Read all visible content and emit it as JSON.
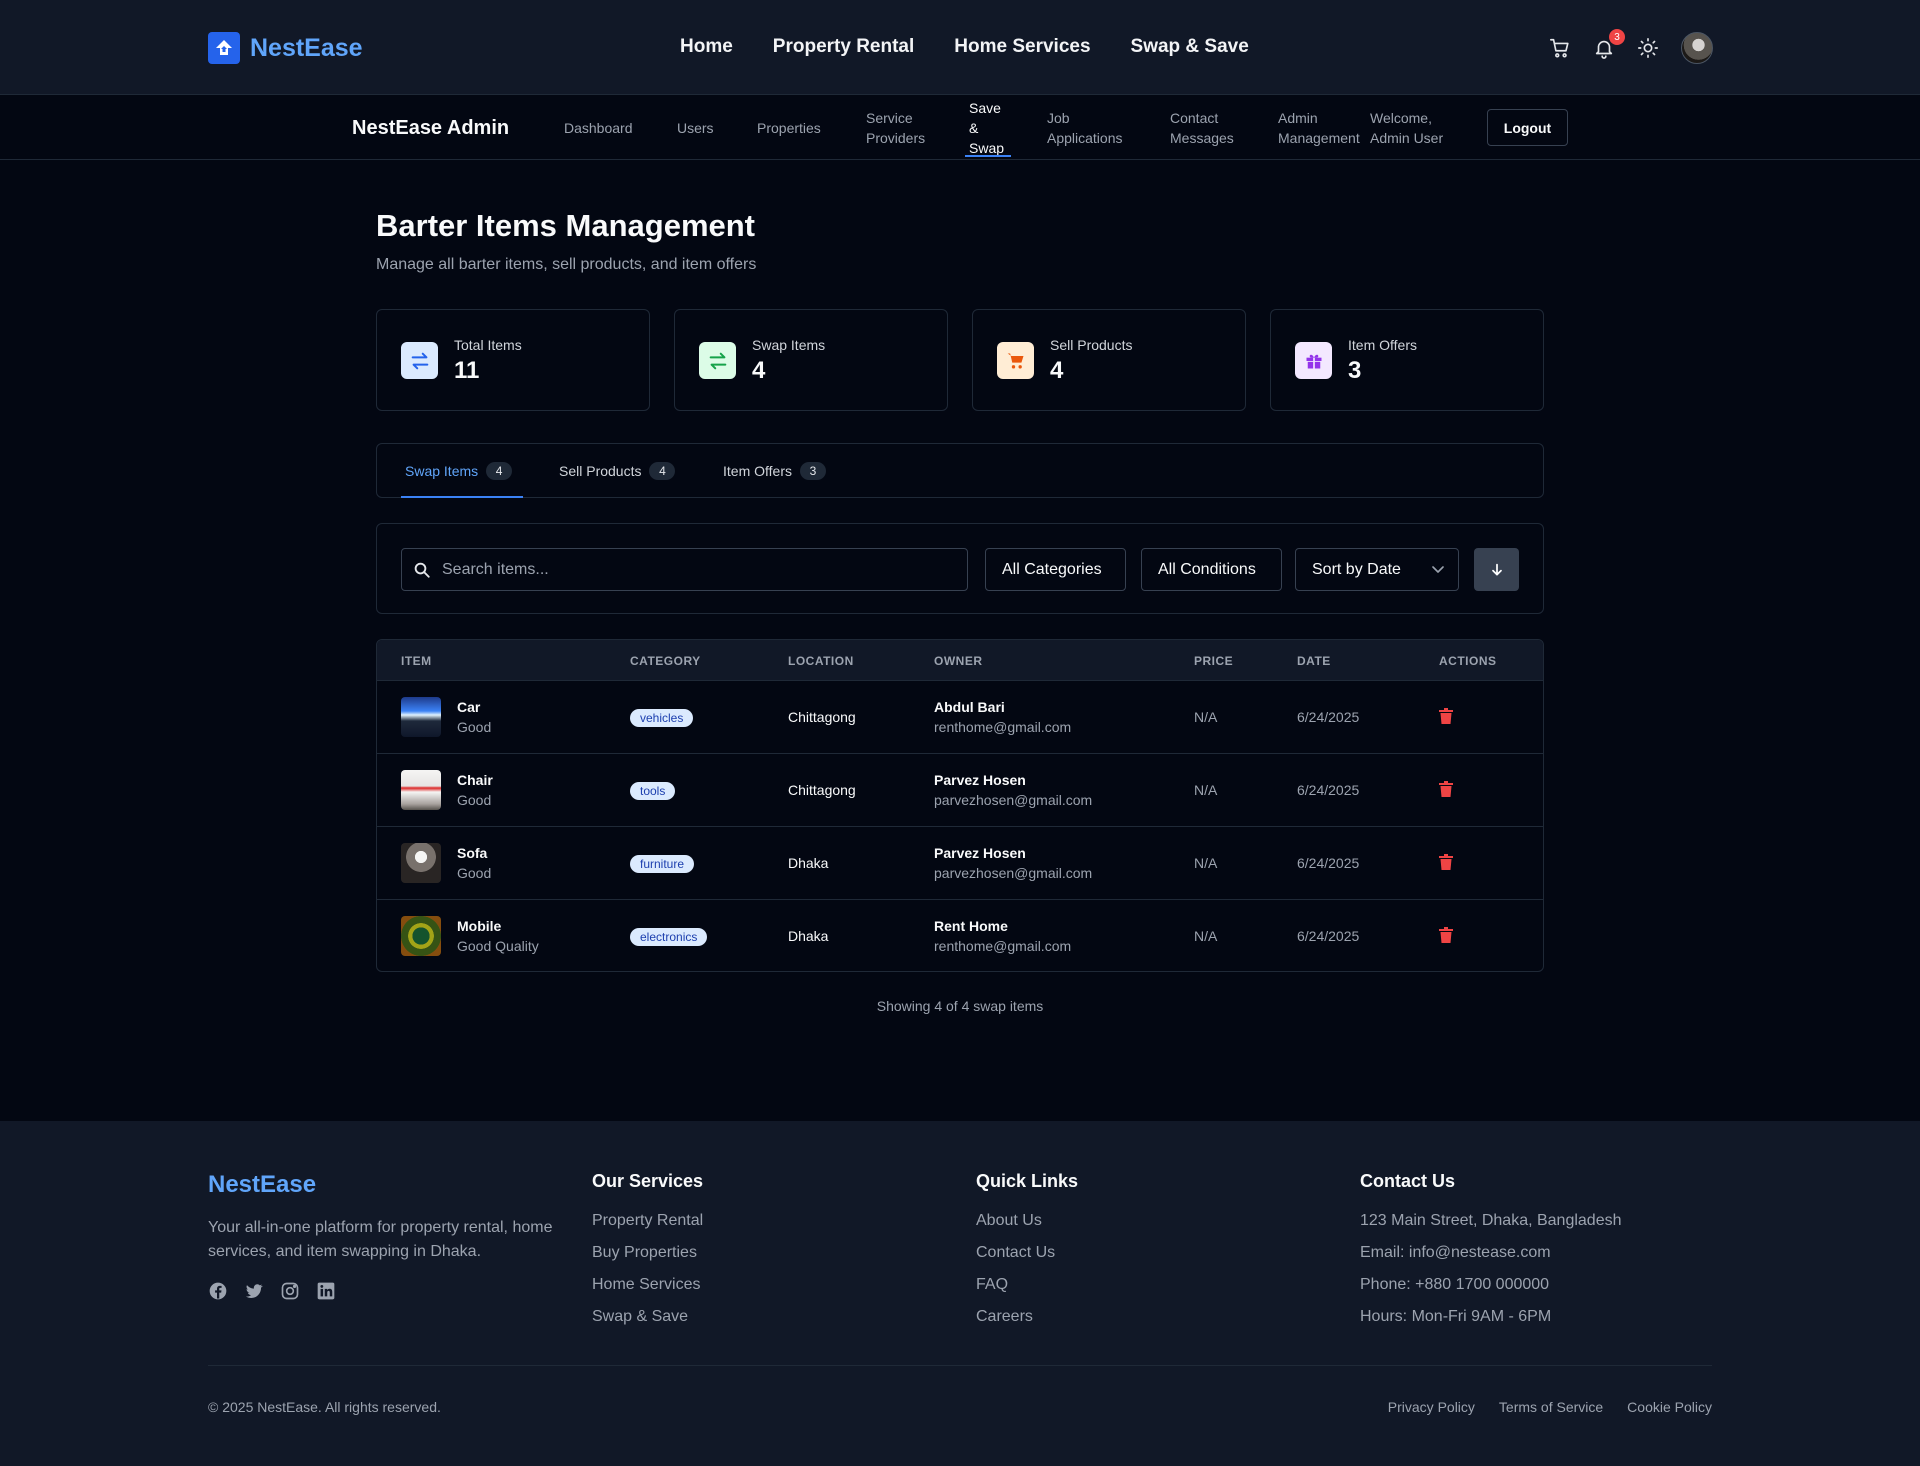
{
  "brand": {
    "name": "NestEase",
    "accent": "#60a5fa"
  },
  "topnav": {
    "links": [
      "Home",
      "Property Rental",
      "Home Services",
      "Swap & Save"
    ],
    "notification_count": "3"
  },
  "adminnav": {
    "title": "NestEase Admin",
    "links": [
      "Dashboard",
      "Users",
      "Properties",
      "Service\nProviders",
      "Save\n&\nSwap",
      "Job\nApplications",
      "Contact\nMessages",
      "Admin\nManagement"
    ],
    "welcome": "Welcome,\nAdmin User",
    "logout": "Logout"
  },
  "header": {
    "title": "Barter Items Management",
    "subtitle": "Manage all barter items, sell products, and item offers"
  },
  "stats": [
    {
      "label": "Total Items",
      "value": "11",
      "icon": "arrows-icon",
      "color": "#2563eb",
      "bg": "#dbeafe"
    },
    {
      "label": "Swap Items",
      "value": "4",
      "icon": "swap-icon",
      "color": "#16a34a",
      "bg": "#dcfce7"
    },
    {
      "label": "Sell Products",
      "value": "4",
      "icon": "cart-icon",
      "color": "#ea580c",
      "bg": "#ffedd5"
    },
    {
      "label": "Item Offers",
      "value": "3",
      "icon": "gift-icon",
      "color": "#9333ea",
      "bg": "#f3e8ff"
    }
  ],
  "tabs": [
    {
      "label": "Swap Items",
      "count": "4"
    },
    {
      "label": "Sell Products",
      "count": "4"
    },
    {
      "label": "Item Offers",
      "count": "3"
    }
  ],
  "filters": {
    "search_placeholder": "Search items...",
    "category": "All Categories",
    "condition": "All Conditions",
    "sort": "Sort by Date"
  },
  "table": {
    "headers": [
      "ITEM",
      "CATEGORY",
      "LOCATION",
      "OWNER",
      "PRICE",
      "DATE",
      "ACTIONS"
    ],
    "rows": [
      {
        "name": "Car",
        "condition": "Good",
        "category": "vehicles",
        "location": "Chittagong",
        "owner": "Abdul Bari",
        "email": "renthome@gmail.com",
        "price": "N/A",
        "date": "6/24/2025"
      },
      {
        "name": "Chair",
        "condition": "Good",
        "category": "tools",
        "location": "Chittagong",
        "owner": "Parvez Hosen",
        "email": "parvezhosen@gmail.com",
        "price": "N/A",
        "date": "6/24/2025"
      },
      {
        "name": "Sofa",
        "condition": "Good",
        "category": "furniture",
        "location": "Dhaka",
        "owner": "Parvez Hosen",
        "email": "parvezhosen@gmail.com",
        "price": "N/A",
        "date": "6/24/2025"
      },
      {
        "name": "Mobile",
        "condition": "Good Quality",
        "category": "electronics",
        "location": "Dhaka",
        "owner": "Rent Home",
        "email": "renthome@gmail.com",
        "price": "N/A",
        "date": "6/24/2025"
      }
    ],
    "showing": "Showing 4 of 4 swap items"
  },
  "footer": {
    "brand": "NestEase",
    "description": "Your all-in-one platform for property rental, home services, and item swapping in Dhaka.",
    "columns": [
      {
        "title": "Our Services",
        "items": [
          "Property Rental",
          "Buy Properties",
          "Home Services",
          "Swap & Save"
        ]
      },
      {
        "title": "Quick Links",
        "items": [
          "About Us",
          "Contact Us",
          "FAQ",
          "Careers"
        ]
      },
      {
        "title": "Contact Us",
        "items": [
          "123 Main Street, Dhaka, Bangladesh",
          "Email: info@nestease.com",
          "Phone: +880 1700 000000",
          "Hours: Mon-Fri 9AM - 6PM"
        ]
      }
    ],
    "copyright": "© 2025 NestEase. All rights reserved.",
    "legal": [
      "Privacy Policy",
      "Terms of Service",
      "Cookie Policy"
    ]
  }
}
